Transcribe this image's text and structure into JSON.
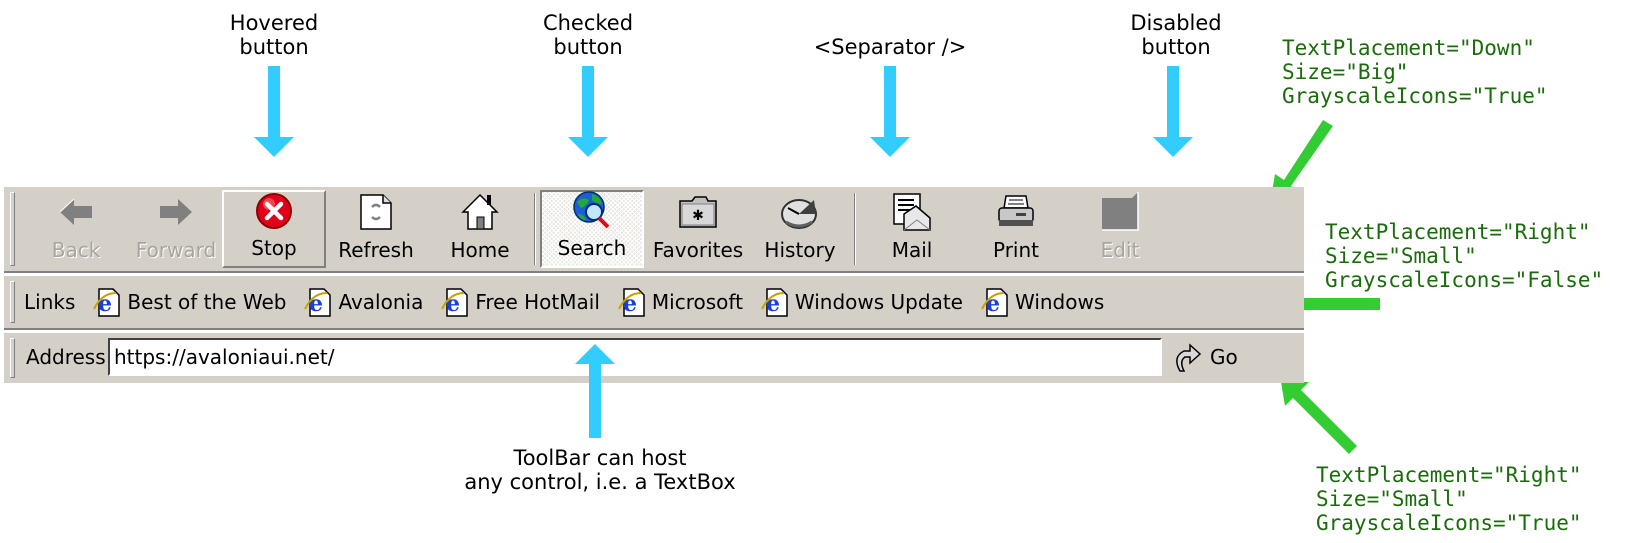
{
  "annotations": {
    "hovered": [
      "Hovered",
      "button"
    ],
    "checked": [
      "Checked",
      "button"
    ],
    "separator": [
      "<Separator />"
    ],
    "disabled": [
      "Disabled",
      "button"
    ],
    "textbox": [
      "ToolBar can host",
      "any control, i.e. a TextBox"
    ]
  },
  "notes": {
    "big_toolbar": "TextPlacement=\"Down\"\nSize=\"Big\"\nGrayscaleIcons=\"True\"",
    "links_toolbar": "TextPlacement=\"Right\"\nSize=\"Small\"\nGrayscaleIcons=\"False\"",
    "address_toolbar": "TextPlacement=\"Right\"\nSize=\"Small\"\nGrayscaleIcons=\"True\""
  },
  "main_toolbar": {
    "buttons": [
      {
        "label": "Back",
        "icon": "back-arrow-icon",
        "state": "disabled"
      },
      {
        "label": "Forward",
        "icon": "forward-arrow-icon",
        "state": "disabled"
      },
      {
        "label": "Stop",
        "icon": "stop-icon",
        "state": "hovered"
      },
      {
        "label": "Refresh",
        "icon": "refresh-icon",
        "state": "normal"
      },
      {
        "label": "Home",
        "icon": "home-icon",
        "state": "normal"
      },
      {
        "label": "Search",
        "icon": "search-globe-icon",
        "state": "checked"
      },
      {
        "label": "Favorites",
        "icon": "favorites-folder-icon",
        "state": "normal"
      },
      {
        "label": "History",
        "icon": "history-clock-icon",
        "state": "normal"
      },
      {
        "label": "Mail",
        "icon": "mail-icon",
        "state": "normal"
      },
      {
        "label": "Print",
        "icon": "printer-icon",
        "state": "normal"
      },
      {
        "label": "Edit",
        "icon": "edit-icon",
        "state": "disabled"
      }
    ]
  },
  "links_toolbar": {
    "label": "Links",
    "items": [
      {
        "label": "Best of the Web"
      },
      {
        "label": "Avalonia"
      },
      {
        "label": "Free HotMail"
      },
      {
        "label": "Microsoft"
      },
      {
        "label": "Windows Update"
      },
      {
        "label": "Windows"
      }
    ]
  },
  "address_toolbar": {
    "label": "Address",
    "value": "https://avaloniaui.net/",
    "go_label": "Go"
  },
  "colors": {
    "annotation_arrow": "#33ccff",
    "note_arrow": "#33cc33",
    "note_text": "#1a6b0a",
    "toolbar_bg": "#d4d0c8"
  }
}
